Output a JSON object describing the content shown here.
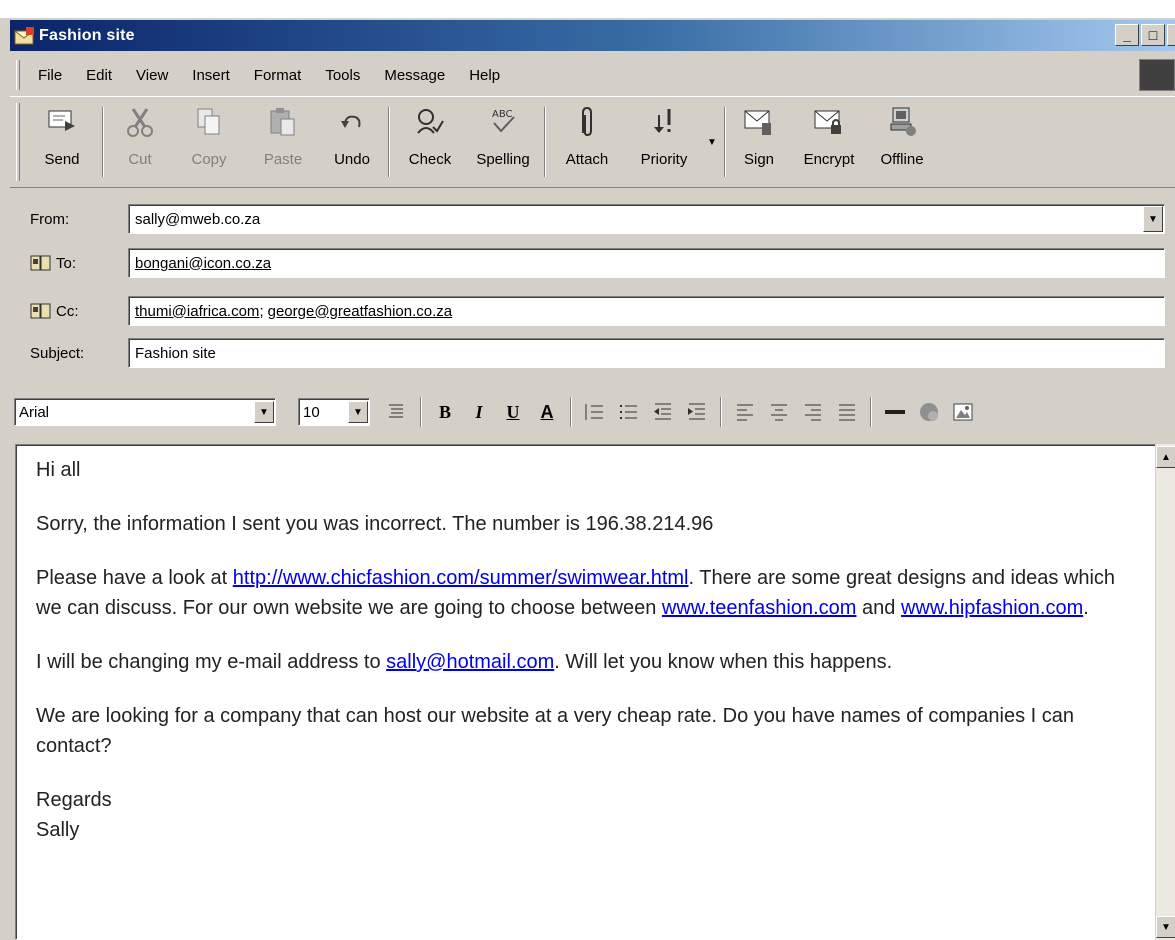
{
  "window": {
    "title": "Fashion site",
    "controls": [
      "_",
      "□",
      "×"
    ]
  },
  "menu": [
    "File",
    "Edit",
    "View",
    "Insert",
    "Format",
    "Tools",
    "Message",
    "Help"
  ],
  "toolbar": {
    "send": "Send",
    "cut": "Cut",
    "copy": "Copy",
    "paste": "Paste",
    "undo": "Undo",
    "check": "Check",
    "spelling": "Spelling",
    "attach": "Attach",
    "priority": "Priority",
    "sign": "Sign",
    "encrypt": "Encrypt",
    "offline": "Offline"
  },
  "header": {
    "from_label": "From:",
    "from_value": "sally@mweb.co.za",
    "to_label": "To:",
    "to_value": "bongani@icon.co.za",
    "cc_label": "Cc:",
    "cc_value1": "thumi@iafrica.com",
    "cc_sep": ";",
    "cc_value2": "george@greatfashion.co.za",
    "subject_label": "Subject:",
    "subject_value": "Fashion site"
  },
  "format": {
    "font": "Arial",
    "size": "10",
    "bold": "B",
    "italic": "I",
    "underline": "U",
    "color": "A"
  },
  "body": {
    "greeting": "Hi all",
    "p1": "Sorry, the information I sent you was incorrect. The number is 196.38.214.96",
    "p2_a": "Please have a look at ",
    "p2_link1": "http://www.chicfashion.com/summer/swimwear.html",
    "p2_b": ". There are some great designs and ideas which we can discuss. For our own website we are going to choose between ",
    "p2_link2": "www.teenfashion.com",
    "p2_c": " and ",
    "p2_link3": "www.hipfashion.com",
    "p2_d": ".",
    "p3_a": "I will be changing my e-mail address to ",
    "p3_link": "sally@hotmail.com",
    "p3_b": ". Will let you know when this happens.",
    "p4": "We are looking for a company that can host our website at a very cheap rate. Do you have names of companies I can contact?",
    "closing": "Regards",
    "signature": "Sally"
  }
}
